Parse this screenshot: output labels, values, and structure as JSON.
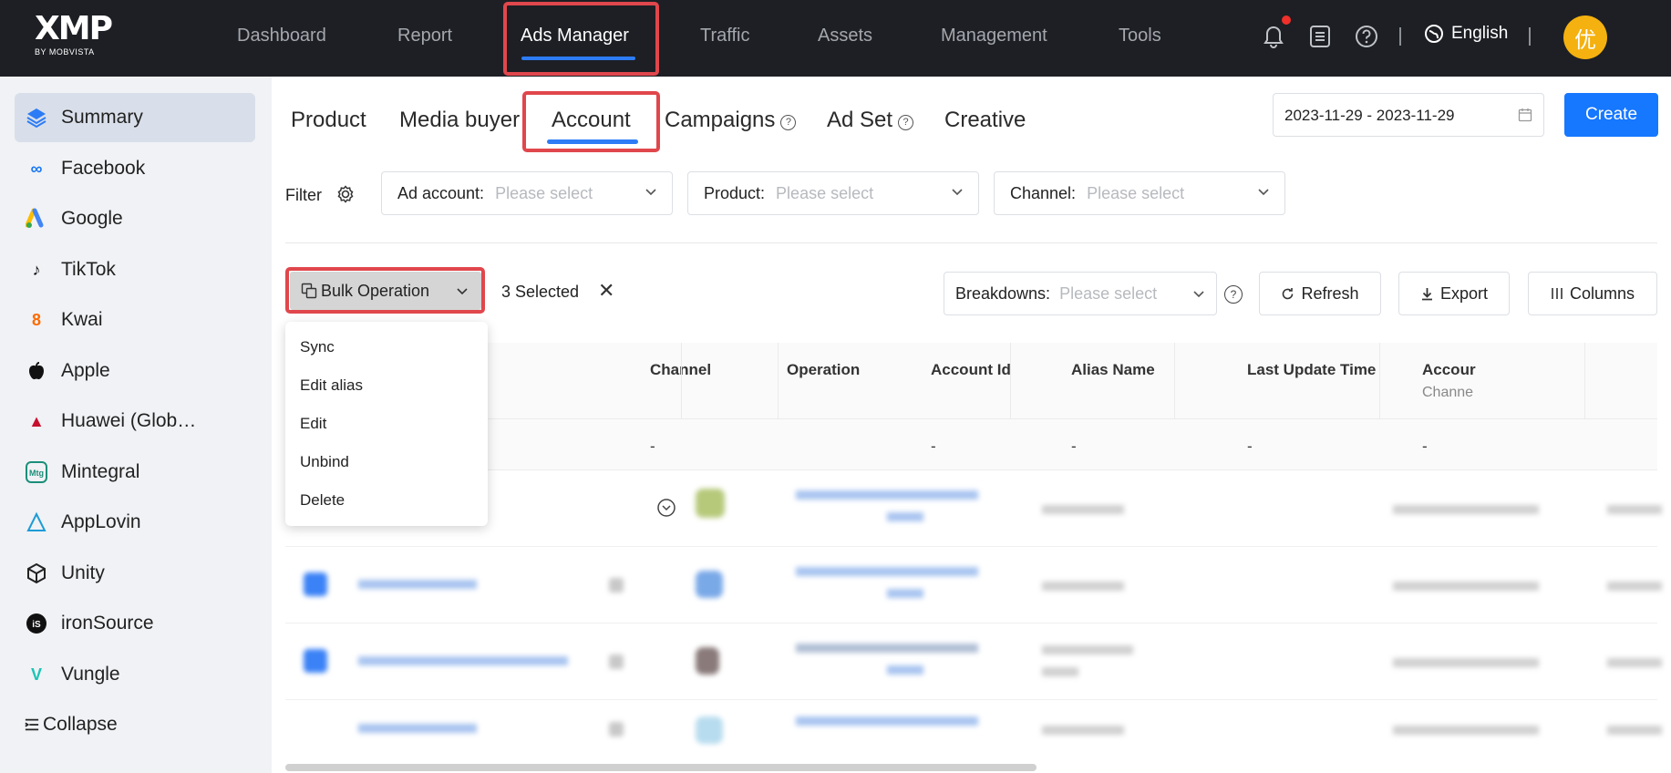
{
  "brand": {
    "logo": "XMP",
    "sub": "BY MOBVISTA"
  },
  "nav": {
    "items": [
      "Dashboard",
      "Report",
      "Ads Manager",
      "Traffic",
      "Assets",
      "Management",
      "Tools"
    ],
    "active": "Ads Manager"
  },
  "header": {
    "language": "English",
    "avatar": "优"
  },
  "sidebar": {
    "items": [
      "Summary",
      "Facebook",
      "Google",
      "TikTok",
      "Kwai",
      "Apple",
      "Huawei (Glob…",
      "Mintegral",
      "AppLovin",
      "Unity",
      "ironSource",
      "Vungle"
    ],
    "active": "Summary",
    "collapse": "Collapse"
  },
  "tabs": {
    "items": [
      "Product",
      "Media buyer",
      "Account",
      "Campaigns",
      "Ad Set",
      "Creative"
    ],
    "active": "Account"
  },
  "date_range": "2023-11-29 - 2023-11-29",
  "create_label": "Create",
  "filter": {
    "label": "Filter",
    "ad_account_label": "Ad account:",
    "product_label": "Product:",
    "channel_label": "Channel:",
    "placeholder": "Please select"
  },
  "toolbar": {
    "bulk_label": "Bulk Operation",
    "selected_text": "3 Selected",
    "breakdowns_label": "Breakdowns:",
    "breakdowns_placeholder": "Please select",
    "refresh": "Refresh",
    "export": "Export",
    "columns": "Columns"
  },
  "bulk_menu": [
    "Sync",
    "Edit alias",
    "Edit",
    "Unbind",
    "Delete"
  ],
  "table": {
    "headers": [
      "Channel",
      "Operation",
      "Account Id",
      "Alias Name",
      "Last Update Time",
      "Accour"
    ],
    "sub_header": "Channe",
    "summary": [
      "-",
      "-",
      "-",
      "-",
      "-"
    ]
  },
  "colors": {
    "accent": "#1677ff",
    "highlight": "#e0474c",
    "topbar": "#1d1f24"
  }
}
